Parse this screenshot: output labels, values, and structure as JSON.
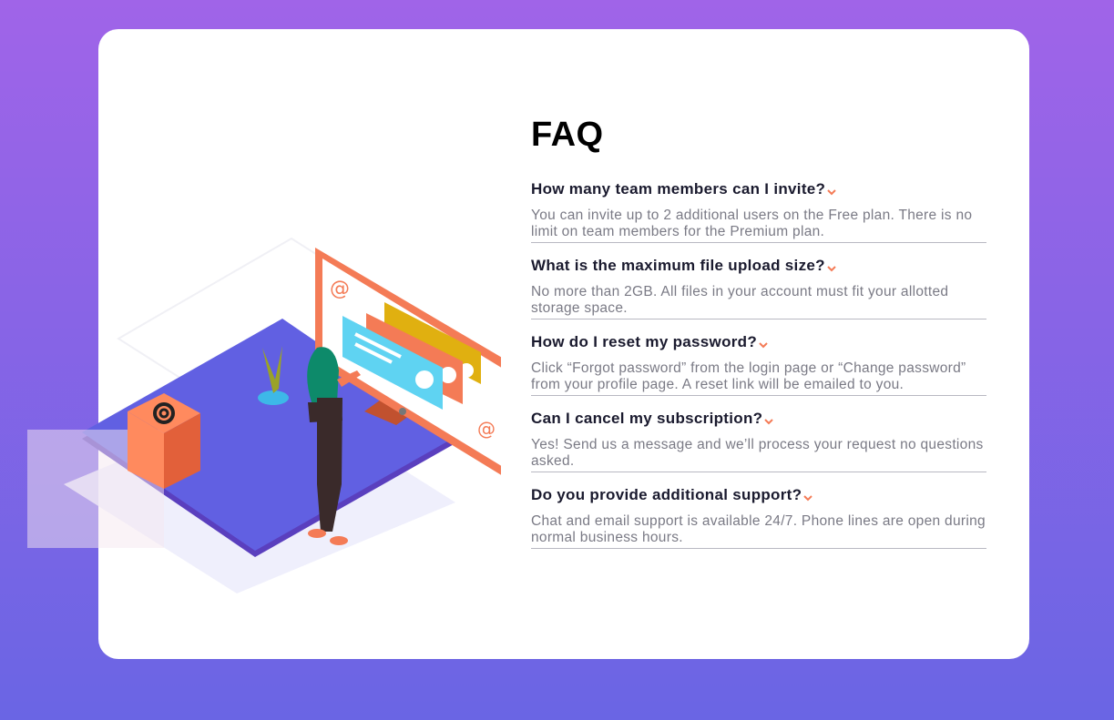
{
  "faq": {
    "title": "FAQ",
    "accent_color": "#f47b56",
    "items": [
      {
        "question": "How many team members can I invite?",
        "answer": "You can invite up to 2 additional users on the Free plan. There is no limit on team members for the Premium plan."
      },
      {
        "question": "What is the maximum file upload size?",
        "answer": "No more than 2GB. All files in your account must fit your allotted storage space."
      },
      {
        "question": "How do I reset my password?",
        "answer": "Click “Forgot password” from the login page or “Change password” from your profile page. A reset link will be emailed to you."
      },
      {
        "question": "Can I cancel my subscription?",
        "answer": "Yes! Send us a message and we’ll process your request no questions asked."
      },
      {
        "question": "Do you provide additional support?",
        "answer": "Chat and email support is available 24/7. Phone lines are open during normal business hours."
      }
    ]
  },
  "illustration": {
    "icon": "woman-at-monitor-illustration",
    "box_icon": "at-sign-icon"
  }
}
